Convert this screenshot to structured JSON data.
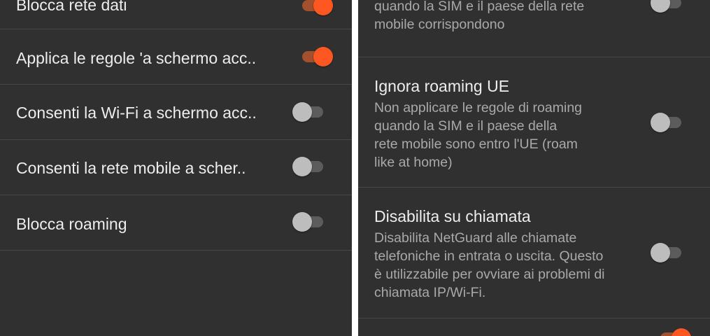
{
  "left_panel": {
    "items": [
      {
        "label": "Blocca rete dati",
        "checked": true
      },
      {
        "label": "Applica le regole 'a schermo acc..",
        "checked": true
      },
      {
        "label": "Consenti la Wi-Fi a schermo acc..",
        "checked": false
      },
      {
        "label": "Consenti la rete mobile a scher..",
        "checked": false
      },
      {
        "label": "Blocca roaming",
        "checked": false
      }
    ]
  },
  "right_panel": {
    "items": [
      {
        "title": "",
        "summary": "Non applicare le regole di roaming\nquando la SIM e il paese della rete\nmobile corrispondono",
        "checked": false
      },
      {
        "title": "Ignora roaming UE",
        "summary": "Non applicare le regole di roaming\nquando la SIM e il paese della\nrete mobile sono entro l'UE (roam\nlike at home)",
        "checked": false
      },
      {
        "title": "Disabilita su chiamata",
        "summary": "Disabilita NetGuard alle chiamate\ntelefoniche in entrata o uscita. Questo\nè utilizzabile per ovviare ai problemi di\nchiamata IP/Wi-Fi.",
        "checked": false
      }
    ]
  },
  "colors": {
    "background": "#303030",
    "accent": "#ff5722",
    "text_primary": "#ededed",
    "text_secondary": "#a9a9a9"
  }
}
